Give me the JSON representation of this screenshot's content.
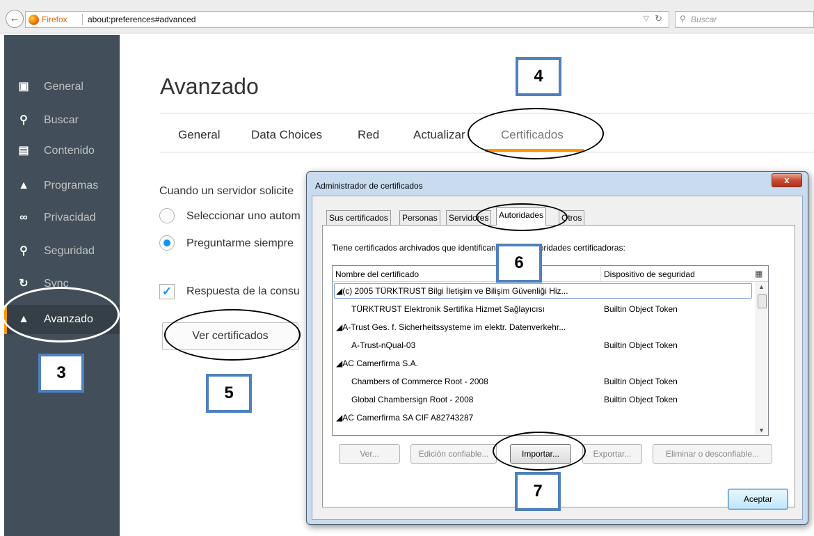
{
  "browser": {
    "identity_label": "Firefox",
    "url": "about:preferences#advanced",
    "search_placeholder": "Buscar"
  },
  "sidebar": {
    "items": [
      {
        "label": "General",
        "icon": "general-icon"
      },
      {
        "label": "Buscar",
        "icon": "search-icon"
      },
      {
        "label": "Contenido",
        "icon": "document-icon"
      },
      {
        "label": "Programas",
        "icon": "rocket-icon"
      },
      {
        "label": "Privacidad",
        "icon": "mask-icon"
      },
      {
        "label": "Seguridad",
        "icon": "lock-icon"
      },
      {
        "label": "Sync",
        "icon": "sync-icon"
      },
      {
        "label": "Avanzado",
        "icon": "wizard-hat-icon",
        "active": true
      }
    ]
  },
  "main": {
    "title": "Avanzado",
    "tabs": [
      "General",
      "Data Choices",
      "Red",
      "Actualizar",
      "Certificados"
    ],
    "active_tab": "Certificados",
    "prompt_text": "Cuando un servidor solicite",
    "radio_auto": "Seleccionar uno autom",
    "radio_ask": "Preguntarme siempre",
    "checkbox_text": "Respuesta de la consu",
    "view_certs_button": "Ver certificados"
  },
  "dialog": {
    "title": "Administrador de certificados",
    "close_label": "x",
    "tabs": [
      "Sus certificados",
      "Personas",
      "Servidores",
      "Autoridades",
      "Otros"
    ],
    "active_tab": "Autoridades",
    "description": "Tiene certificados archivados que identifican a estas autoridades certificadoras:",
    "columns": {
      "name": "Nombre del certificado",
      "device": "Dispositivo de seguridad"
    },
    "rows": [
      {
        "name": "◢(c) 2005 TÜRKTRUST Bilgi İletişim ve Bilişim Güvenliği Hiz...",
        "device": "",
        "group": true
      },
      {
        "name": "TÜRKTRUST Elektronik Sertifika Hizmet Sağlayıcısı",
        "device": "Builtin Object Token",
        "group": false
      },
      {
        "name": "◢A-Trust Ges. f. Sicherheitssysteme im elektr. Datenverkehr...",
        "device": "",
        "group": true
      },
      {
        "name": "A-Trust-nQual-03",
        "device": "Builtin Object Token",
        "group": false
      },
      {
        "name": "◢AC Camerfirma S.A.",
        "device": "",
        "group": true
      },
      {
        "name": "Chambers of Commerce Root - 2008",
        "device": "Builtin Object Token",
        "group": false
      },
      {
        "name": "Global Chambersign Root - 2008",
        "device": "Builtin Object Token",
        "group": false
      },
      {
        "name": "◢AC Camerfirma SA CIF A82743287",
        "device": "",
        "group": true
      }
    ],
    "buttons": {
      "view": "Ver...",
      "edit": "Edición confiable...",
      "import": "Importar...",
      "export": "Exportar...",
      "delete": "Eliminar o desconfiable..."
    },
    "ok_button": "Aceptar"
  },
  "annotations": {
    "step3": "3",
    "step4": "4",
    "step5": "5",
    "step6": "6",
    "step7": "7",
    "box_border_color": "#4f81bd"
  }
}
